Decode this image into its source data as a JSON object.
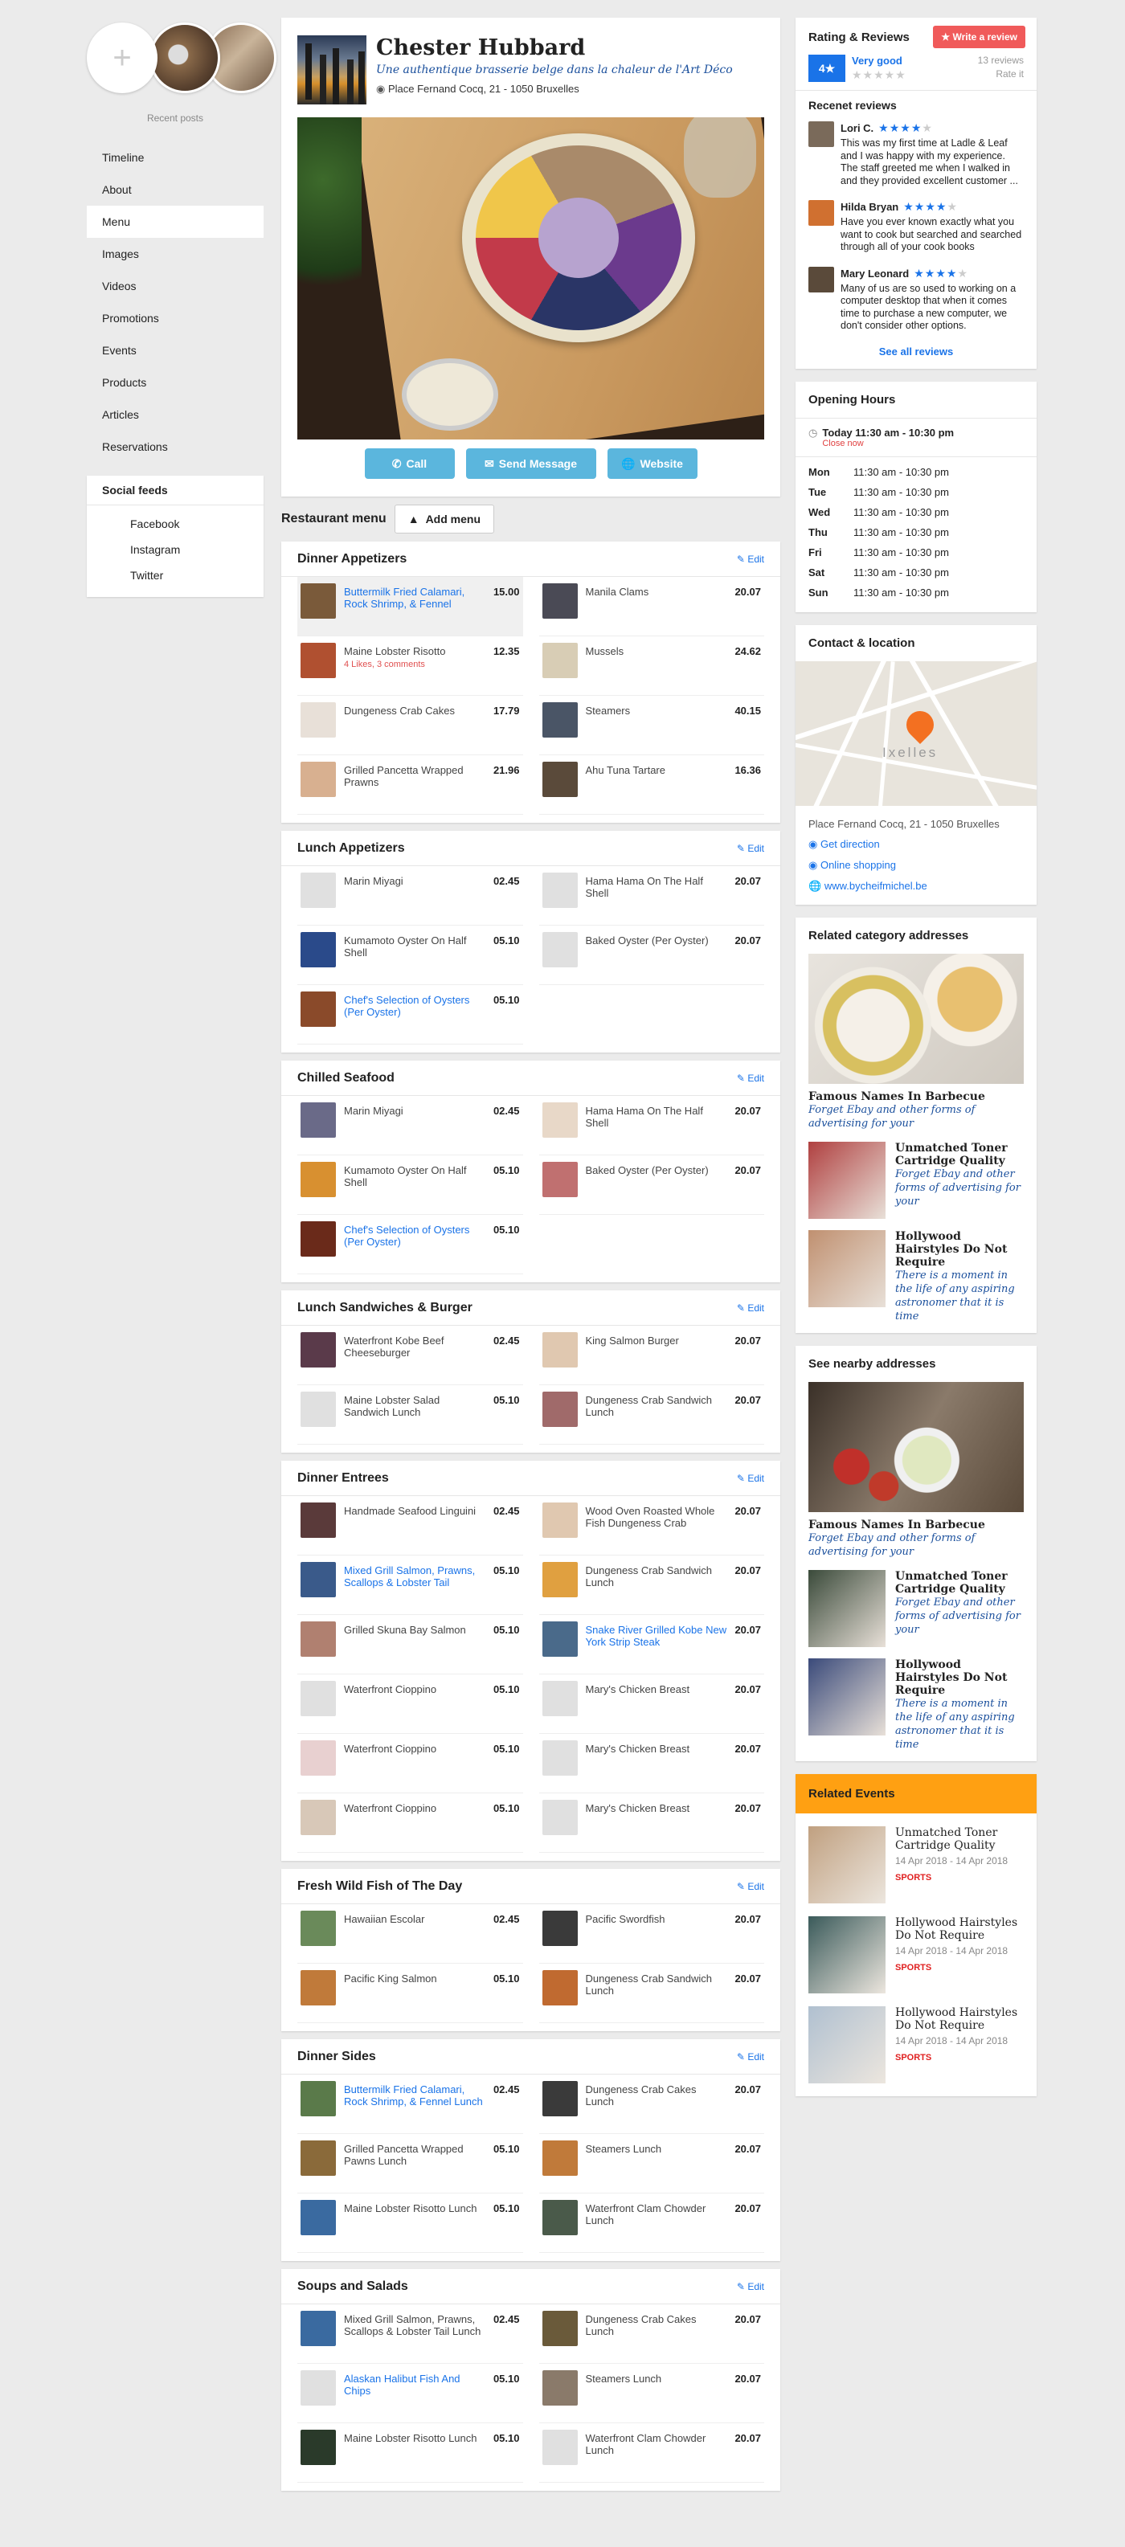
{
  "left": {
    "recent_label": "Recent posts",
    "nav": [
      "Timeline",
      "About",
      "Menu",
      "Images",
      "Videos",
      "Promotions",
      "Events",
      "Products",
      "Articles",
      "Reservations"
    ],
    "active_nav": "Menu",
    "social_title": "Social feeds",
    "social": [
      "Facebook",
      "Instagram",
      "Twitter"
    ]
  },
  "header": {
    "name": "Chester Hubbard",
    "tagline": "Une authentique brasserie belge dans la chaleur de l'Art Déco",
    "address": "Place Fernand Cocq, 21 - 1050 Bruxelles",
    "buttons": {
      "call": "Call",
      "message": "Send Message",
      "website": "Website"
    }
  },
  "menu_bar": {
    "label": "Restaurant menu",
    "add": "Add menu"
  },
  "edit_label": "Edit",
  "sections": [
    {
      "title": "Dinner Appetizers",
      "items": [
        {
          "name": "Buttermilk Fried Calamari, Rock Shrimp, & Fennel",
          "price": "15.00",
          "link": true,
          "hl": true,
          "c": "#7a5a3a"
        },
        {
          "name": "Manila Clams",
          "price": "20.07",
          "c": "#4a4a55"
        },
        {
          "name": "Maine Lobster Risotto",
          "price": "12.35",
          "sub": "4 Likes, 3 comments",
          "c": "#b05030"
        },
        {
          "name": "Mussels",
          "price": "24.62",
          "c": "#d8cdb5"
        },
        {
          "name": "Dungeness Crab Cakes",
          "price": "17.79",
          "c": "#e8e0d8"
        },
        {
          "name": "Steamers",
          "price": "40.15",
          "c": "#4a5566"
        },
        {
          "name": "Grilled Pancetta Wrapped Prawns",
          "price": "21.96",
          "c": "#d8b090"
        },
        {
          "name": "Ahu Tuna Tartare",
          "price": "16.36",
          "c": "#5a4a3a"
        }
      ]
    },
    {
      "title": "Lunch Appetizers",
      "items": [
        {
          "name": "Marin Miyagi",
          "price": "02.45",
          "c": "#e0e0e0"
        },
        {
          "name": "Hama Hama On The Half Shell",
          "price": "20.07",
          "c": "#e0e0e0"
        },
        {
          "name": "Kumamoto Oyster On Half Shell",
          "price": "05.10",
          "c": "#2a4a8a"
        },
        {
          "name": "Baked Oyster (Per Oyster)",
          "price": "20.07",
          "c": "#e0e0e0"
        },
        {
          "name": "Chef's Selection of Oysters (Per Oyster)",
          "price": "05.10",
          "link": true,
          "c": "#8a4a2a"
        }
      ]
    },
    {
      "title": "Chilled Seafood",
      "items": [
        {
          "name": "Marin Miyagi",
          "price": "02.45",
          "c": "#6a6a88"
        },
        {
          "name": "Hama Hama On The Half Shell",
          "price": "20.07",
          "c": "#e8d8c8"
        },
        {
          "name": "Kumamoto Oyster On Half Shell",
          "price": "05.10",
          "c": "#d89030"
        },
        {
          "name": "Baked Oyster (Per Oyster)",
          "price": "20.07",
          "c": "#c07070"
        },
        {
          "name": "Chef's Selection of Oysters (Per Oyster)",
          "price": "05.10",
          "link": true,
          "c": "#6a2a1a"
        }
      ]
    },
    {
      "title": "Lunch Sandwiches & Burger",
      "items": [
        {
          "name": "Waterfront Kobe Beef Cheeseburger",
          "price": "02.45",
          "c": "#5a3a4a"
        },
        {
          "name": "King Salmon Burger",
          "price": "20.07",
          "c": "#e0c8b0"
        },
        {
          "name": "Maine Lobster Salad Sandwich Lunch",
          "price": "05.10",
          "c": "#e0e0e0"
        },
        {
          "name": "Dungeness Crab Sandwich Lunch",
          "price": "20.07",
          "c": "#a06a6a"
        }
      ]
    },
    {
      "title": "Dinner Entrees",
      "items": [
        {
          "name": "Handmade Seafood Linguini",
          "price": "02.45",
          "c": "#5a3a3a"
        },
        {
          "name": "Wood Oven Roasted Whole Fish Dungeness Crab",
          "price": "20.07",
          "c": "#e0c8b0"
        },
        {
          "name": "Mixed Grill Salmon, Prawns, Scallops & Lobster Tail",
          "price": "05.10",
          "link": true,
          "c": "#3a5a8a"
        },
        {
          "name": "Dungeness Crab Sandwich Lunch",
          "price": "20.07",
          "c": "#e0a040"
        },
        {
          "name": "Grilled Skuna Bay Salmon",
          "price": "05.10",
          "c": "#b08070"
        },
        {
          "name": "Snake River Grilled Kobe New York Strip Steak",
          "price": "20.07",
          "link": true,
          "c": "#4a6a8a"
        },
        {
          "name": "Waterfront Cioppino",
          "price": "05.10",
          "c": "#e0e0e0"
        },
        {
          "name": "Mary's Chicken Breast",
          "price": "20.07",
          "c": "#e0e0e0"
        },
        {
          "name": "Waterfront Cioppino",
          "price": "05.10",
          "c": "#e8d0d0"
        },
        {
          "name": "Mary's Chicken Breast",
          "price": "20.07",
          "c": "#e0e0e0"
        },
        {
          "name": "Waterfront Cioppino",
          "price": "05.10",
          "c": "#d8c8b8"
        },
        {
          "name": "Mary's Chicken Breast",
          "price": "20.07",
          "c": "#e0e0e0"
        }
      ]
    },
    {
      "title": "Fresh Wild Fish of The Day",
      "items": [
        {
          "name": "Hawaiian Escolar",
          "price": "02.45",
          "c": "#6a8a5a"
        },
        {
          "name": "Pacific Swordfish",
          "price": "20.07",
          "c": "#3a3a3a"
        },
        {
          "name": "Pacific King Salmon",
          "price": "05.10",
          "c": "#c07a3a"
        },
        {
          "name": "Dungeness Crab Sandwich Lunch",
          "price": "20.07",
          "c": "#c06a30"
        }
      ]
    },
    {
      "title": "Dinner Sides",
      "items": [
        {
          "name": "Buttermilk Fried Calamari, Rock Shrimp, & Fennel Lunch",
          "price": "02.45",
          "link": true,
          "c": "#5a7a4a"
        },
        {
          "name": "Dungeness Crab Cakes Lunch",
          "price": "20.07",
          "c": "#3a3a3a"
        },
        {
          "name": "Grilled Pancetta Wrapped Pawns Lunch",
          "price": "05.10",
          "c": "#8a6a3a"
        },
        {
          "name": "Steamers Lunch",
          "price": "20.07",
          "c": "#c07a3a"
        },
        {
          "name": "Maine Lobster Risotto Lunch",
          "price": "05.10",
          "c": "#3a6aa0"
        },
        {
          "name": "Waterfront Clam Chowder Lunch",
          "price": "20.07",
          "c": "#4a5a4a"
        }
      ]
    },
    {
      "title": "Soups and Salads",
      "items": [
        {
          "name": "Mixed Grill Salmon, Prawns, Scallops & Lobster Tail Lunch",
          "price": "02.45",
          "c": "#3a6aa0"
        },
        {
          "name": "Dungeness Crab Cakes Lunch",
          "price": "20.07",
          "c": "#6a5a3a"
        },
        {
          "name": "Alaskan Halibut Fish And Chips",
          "price": "05.10",
          "link": true,
          "c": "#e0e0e0"
        },
        {
          "name": "Steamers Lunch",
          "price": "20.07",
          "c": "#8a7a6a"
        },
        {
          "name": "Maine Lobster Risotto Lunch",
          "price": "05.10",
          "c": "#2a3a2a"
        },
        {
          "name": "Waterfront Clam Chowder Lunch",
          "price": "20.07",
          "c": "#e0e0e0"
        }
      ]
    }
  ],
  "rating": {
    "title": "Rating & Reviews",
    "write": "Write a review",
    "score": "4",
    "label": "Very good",
    "count": "13 reviews",
    "rate_it": "Rate it",
    "recent_title": "Recenet reviews",
    "reviews": [
      {
        "name": "Lori C.",
        "stars": 4,
        "text": "This was my first time at Ladle & Leaf and I was happy with my experience. The staff greeted me when I walked in and they provided excellent customer ...",
        "c": "#7a6a5a"
      },
      {
        "name": "Hilda Bryan",
        "stars": 4,
        "text": "Have you ever known exactly what you want to cook but searched and searched through all of your cook books",
        "c": "#d07030"
      },
      {
        "name": "Mary Leonard",
        "stars": 4,
        "text": "Many of us are so used to working on a computer desktop that when it comes time to purchase a new computer, we don't consider other options.",
        "c": "#5a4a3a"
      }
    ],
    "see_all": "See all reviews"
  },
  "hours": {
    "title": "Opening Hours",
    "today": "Today 11:30 am - 10:30 pm",
    "status": "Close now",
    "days": [
      {
        "d": "Mon",
        "h": "11:30 am - 10:30 pm"
      },
      {
        "d": "Tue",
        "h": "11:30 am - 10:30 pm"
      },
      {
        "d": "Wed",
        "h": "11:30 am - 10:30 pm"
      },
      {
        "d": "Thu",
        "h": "11:30 am - 10:30 pm"
      },
      {
        "d": "Fri",
        "h": "11:30 am - 10:30 pm"
      },
      {
        "d": "Sat",
        "h": "11:30 am - 10:30 pm"
      },
      {
        "d": "Sun",
        "h": "11:30 am - 10:30 pm"
      }
    ]
  },
  "contact": {
    "title": "Contact & location",
    "map_label": "Ixelles",
    "address": "Place Fernand Cocq, 21 - 1050 Bruxelles",
    "direction": "Get direction",
    "shop": "Online shopping",
    "web": "www.bycheifmichel.be"
  },
  "related": {
    "title": "Related category addresses",
    "big_title": "Famous Names In Barbecue",
    "big_desc": "Forget Ebay and other forms of advertising for your",
    "items": [
      {
        "title": "Unmatched Toner Cartridge Quality",
        "desc": "Forget Ebay and other forms of advertising for your",
        "c": "#b04040"
      },
      {
        "title": "Hollywood Hairstyles Do Not Require",
        "desc": "There is a moment in the life of any aspiring astronomer that it is time",
        "c": "#c09070"
      }
    ]
  },
  "nearby": {
    "title": "See nearby addresses",
    "big_title": "Famous Names In Barbecue",
    "big_desc": "Forget Ebay and other forms of advertising for your",
    "items": [
      {
        "title": "Unmatched Toner Cartridge Quality",
        "desc": "Forget Ebay and other forms of advertising for your",
        "c": "#3a4a3a"
      },
      {
        "title": "Hollywood Hairstyles Do Not Require",
        "desc": "There is a moment in the life of any aspiring astronomer that it is time",
        "c": "#3a4a7a"
      }
    ]
  },
  "events": {
    "title": "Related Events",
    "items": [
      {
        "title": "Unmatched Toner Cartridge Quality",
        "date": "14 Apr 2018 - 14 Apr 2018",
        "cat": "SPORTS",
        "c": "#c0a080"
      },
      {
        "title": "Hollywood Hairstyles Do Not Require",
        "date": "14 Apr 2018 - 14 Apr 2018",
        "cat": "SPORTS",
        "c": "#3a5a5a"
      },
      {
        "title": "Hollywood Hairstyles Do Not Require",
        "date": "14 Apr 2018 - 14 Apr 2018",
        "cat": "SPORTS",
        "c": "#b0c0d0"
      }
    ]
  }
}
